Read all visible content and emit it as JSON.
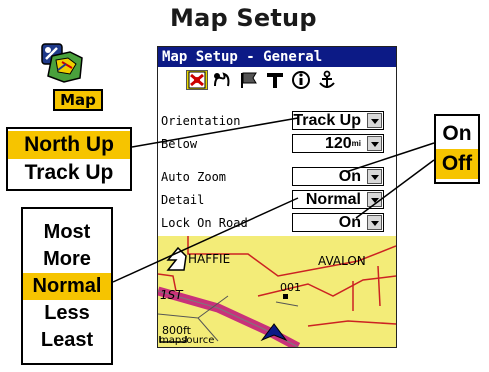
{
  "heading": "Map Setup",
  "app": {
    "icon": "map-app-icon",
    "label": "Map"
  },
  "screen": {
    "title": "Map Setup - General",
    "tabs": [
      {
        "icon": "map-general-tab-icon",
        "selected": true
      },
      {
        "icon": "map-tracks-tab-icon",
        "selected": false
      },
      {
        "icon": "map-points-tab-icon",
        "selected": false
      },
      {
        "icon": "map-text-tab-icon",
        "selected": false
      },
      {
        "icon": "map-information-tab-icon",
        "selected": false
      },
      {
        "icon": "map-marine-tab-icon",
        "selected": false
      }
    ],
    "settings": {
      "orientation": {
        "label": "Orientation",
        "value": "Track Up"
      },
      "below": {
        "label": "Below",
        "value": "120",
        "unit": "mi"
      },
      "auto_zoom": {
        "label": "Auto Zoom",
        "value": "On"
      },
      "detail": {
        "label": "Detail",
        "value": "Normal"
      },
      "lock_on_road": {
        "label": "Lock On Road",
        "value": "On"
      }
    },
    "map": {
      "labels": {
        "haffie": "HAFFIE",
        "avalon": "AVALON",
        "waypoint": "001",
        "street": "1ST",
        "scale": "800ft",
        "source": "mapsource"
      }
    }
  },
  "callouts": {
    "orientation_options": [
      "North Up",
      "Track Up"
    ],
    "orientation_selected": "North Up",
    "on_off_options": [
      "On",
      "Off"
    ],
    "on_off_selected": "Off",
    "detail_options": [
      "Most",
      "More",
      "Normal",
      "Less",
      "Least"
    ],
    "detail_selected": "Normal"
  },
  "colors": {
    "highlight": "#f6c400",
    "titlebar": "#0c1a86",
    "map_land": "#f3ec78",
    "road": "#c8327a",
    "boundary": "#cc2222"
  }
}
